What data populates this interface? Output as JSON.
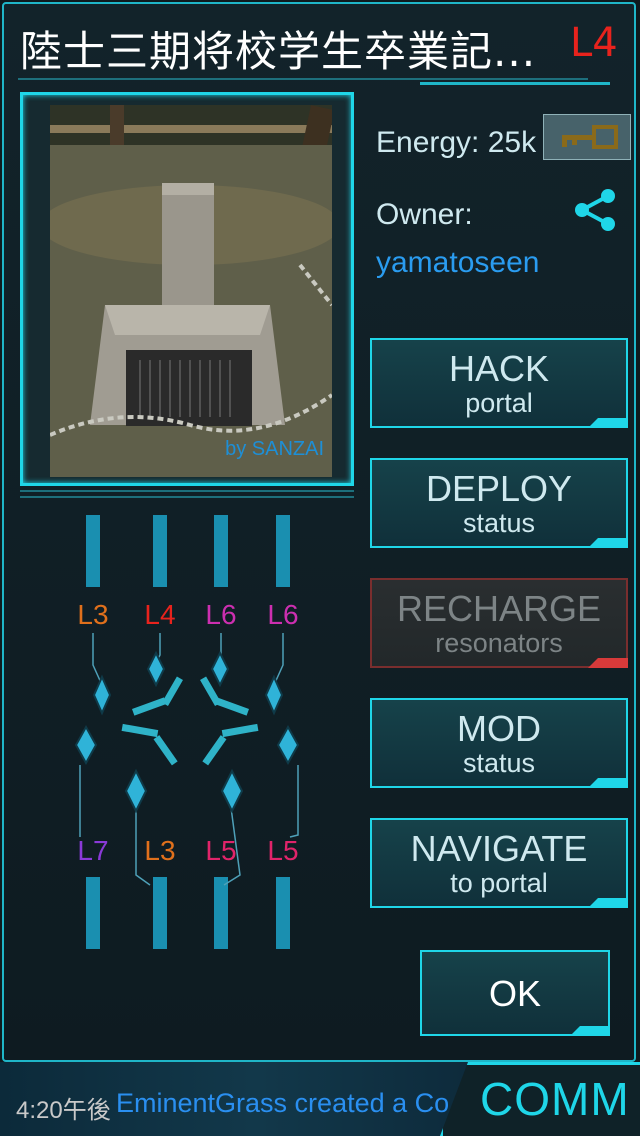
{
  "portal": {
    "title": "陸士三期将校学生卒業記...",
    "level": "L4",
    "photo_credit": "by SANZAI",
    "energy_label": "Energy: 25k",
    "owner_label": "Owner:",
    "owner_name": "yamatoseen"
  },
  "buttons": {
    "hack": {
      "line1": "HACK",
      "line2": "portal"
    },
    "deploy": {
      "line1": "DEPLOY",
      "line2": "status"
    },
    "recharge": {
      "line1": "RECHARGE",
      "line2": "resonators"
    },
    "mod": {
      "line1": "MOD",
      "line2": "status"
    },
    "navigate": {
      "line1": "NAVIGATE",
      "line2": "to portal"
    },
    "ok": "OK"
  },
  "resonators": {
    "top": [
      {
        "level": "L3",
        "color": "#e0701c"
      },
      {
        "level": "L4",
        "color": "#e8231d"
      },
      {
        "level": "L6",
        "color": "#cc2fb0"
      },
      {
        "level": "L6",
        "color": "#cc2fb0"
      }
    ],
    "bottom": [
      {
        "level": "L7",
        "color": "#8a3ad8"
      },
      {
        "level": "L3",
        "color": "#e0701c"
      },
      {
        "level": "L5",
        "color": "#e0246a"
      },
      {
        "level": "L5",
        "color": "#e0246a"
      }
    ]
  },
  "comm": {
    "time": "4:20午後",
    "message": "EminentGrass created a Co",
    "tab_label": "COMM"
  },
  "colors": {
    "accent": "#1fd6e8",
    "level_red": "#e8231d",
    "owner_blue": "#2a9cf0"
  },
  "icons": {
    "key": "key-icon",
    "share": "share-icon"
  }
}
